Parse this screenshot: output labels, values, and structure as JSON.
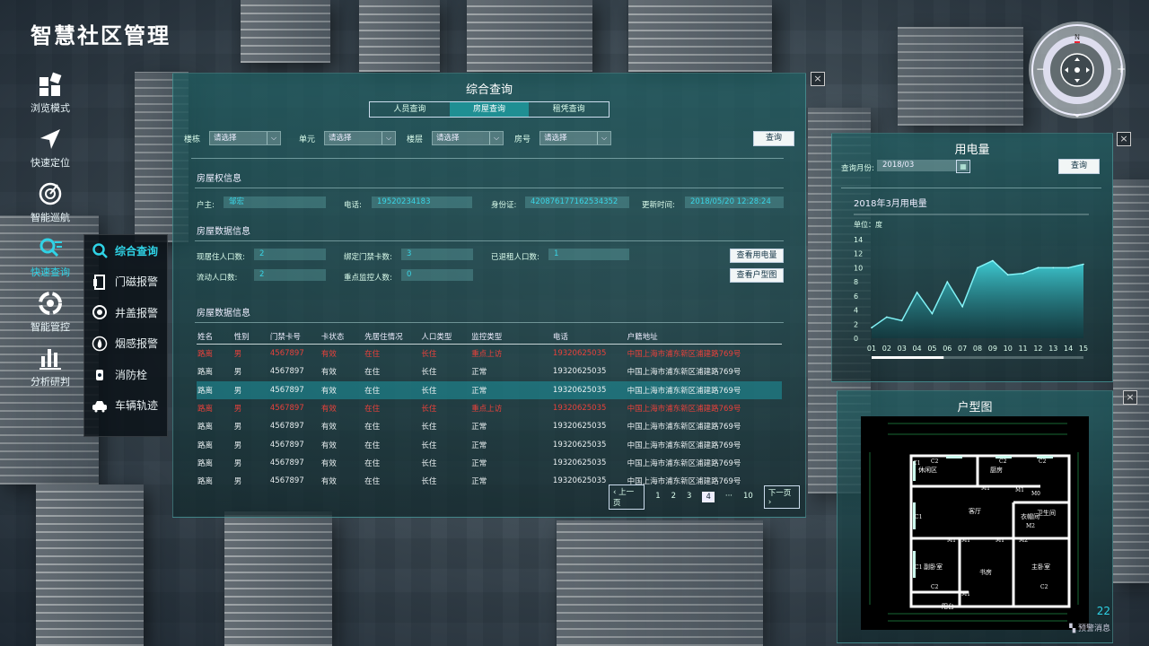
{
  "app_title": "智慧社区管理",
  "nav": [
    {
      "label": "浏览模式",
      "icon": "grid-icon"
    },
    {
      "label": "快速定位",
      "icon": "locate-arrow-icon"
    },
    {
      "label": "智能巡航",
      "icon": "radar-icon"
    },
    {
      "label": "快速查询",
      "icon": "search-list-icon",
      "active": true
    },
    {
      "label": "智能管控",
      "icon": "control-icon"
    },
    {
      "label": "分析研判",
      "icon": "bar-chart-icon"
    }
  ],
  "submenu": [
    {
      "label": "综合查询",
      "icon": "search-icon",
      "active": true
    },
    {
      "label": "门磁报警",
      "icon": "door-icon"
    },
    {
      "label": "井盖报警",
      "icon": "manhole-icon"
    },
    {
      "label": "烟感报警",
      "icon": "fire-icon"
    },
    {
      "label": "消防栓",
      "icon": "hydrant-icon"
    },
    {
      "label": "车辆轨迹",
      "icon": "car-icon"
    }
  ],
  "main": {
    "title": "综合查询",
    "close": "×",
    "tabs": [
      "人员查询",
      "房屋查询",
      "租凭查询"
    ],
    "filters": {
      "building_label": "楼栋",
      "unit_label": "单元",
      "floor_label": "楼层",
      "room_label": "房号",
      "select_value": "请选择",
      "query": "查询"
    },
    "ownership": {
      "heading": "房屋权信息",
      "owner_label": "户主:",
      "owner": "邹宏",
      "phone_label": "电话:",
      "phone": "19520234183",
      "id_label": "身份证:",
      "id": "420876177162534352",
      "updated_label": "更新时间:",
      "updated": "2018/05/20  12:28:24"
    },
    "stats": {
      "heading": "房屋数据信息",
      "resident_label": "现居住人口数:",
      "resident": "2",
      "card_label": "绑定门禁卡数:",
      "card": "3",
      "rented_label": "已退租人口数:",
      "rented": "1",
      "floating_label": "流动人口数:",
      "floating": "2",
      "monitor_label": "重点监控人数:",
      "monitor": "0",
      "btn_power": "查看用电量",
      "btn_plan": "查看户型图"
    },
    "table": {
      "heading": "房屋数据信息",
      "columns": [
        "姓名",
        "性别",
        "门禁卡号",
        "卡状态",
        "先居住情况",
        "人口类型",
        "监控类型",
        "电话",
        "户籍地址"
      ],
      "rows": [
        [
          "路离",
          "男",
          "4567897",
          "有效",
          "在住",
          "长住",
          "重点上访",
          "19320625035",
          "中国上海市浦东新区浦建路769号"
        ],
        [
          "路离",
          "男",
          "4567897",
          "有效",
          "在住",
          "长住",
          "正常",
          "19320625035",
          "中国上海市浦东新区浦建路769号"
        ],
        [
          "路离",
          "男",
          "4567897",
          "有效",
          "在住",
          "长住",
          "正常",
          "19320625035",
          "中国上海市浦东新区浦建路769号"
        ],
        [
          "路离",
          "男",
          "4567897",
          "有效",
          "在住",
          "长住",
          "重点上访",
          "19320625035",
          "中国上海市浦东新区浦建路769号"
        ],
        [
          "路离",
          "男",
          "4567897",
          "有效",
          "在住",
          "长住",
          "正常",
          "19320625035",
          "中国上海市浦东新区浦建路769号"
        ],
        [
          "路离",
          "男",
          "4567897",
          "有效",
          "在住",
          "长住",
          "正常",
          "19320625035",
          "中国上海市浦东新区浦建路769号"
        ],
        [
          "路离",
          "男",
          "4567897",
          "有效",
          "在住",
          "长住",
          "正常",
          "19320625035",
          "中国上海市浦东新区浦建路769号"
        ],
        [
          "路离",
          "男",
          "4567897",
          "有效",
          "在住",
          "长住",
          "正常",
          "19320625035",
          "中国上海市浦东新区浦建路769号"
        ]
      ],
      "red_rows": [
        0,
        3
      ],
      "highlight_row": 2
    },
    "pager": {
      "prev": "上一页",
      "next": "下一页",
      "pages": [
        "1",
        "2",
        "3",
        "4",
        "···",
        "10"
      ],
      "active": "4"
    }
  },
  "power": {
    "title": "用电量",
    "month_label": "查询月份:",
    "month_value": "2018/03",
    "query": "查询",
    "close": "×"
  },
  "chart_data": {
    "type": "area",
    "title": "2018年3月用电量",
    "ylabel": "单位：度",
    "categories": [
      "01",
      "02",
      "03",
      "04",
      "05",
      "06",
      "07",
      "08",
      "09",
      "10",
      "11",
      "12",
      "13",
      "14",
      "15"
    ],
    "values": [
      1.5,
      3,
      2.5,
      6.5,
      3.5,
      8,
      4.5,
      10,
      11,
      9,
      9.2,
      10,
      10,
      10,
      10.5
    ],
    "ylim": [
      0,
      14
    ],
    "yticks": [
      "0",
      "2",
      "4",
      "6",
      "8",
      "10",
      "12",
      "14"
    ],
    "color": "#3fd0d8"
  },
  "plan": {
    "title": "户型图",
    "close": "×",
    "rooms": [
      "休闲区",
      "厨房",
      "客厅",
      "卫生间",
      "衣帽间",
      "副卧室",
      "书房",
      "主卧室",
      "阳台"
    ],
    "codes": [
      "C1",
      "C2",
      "C2",
      "C2",
      "M1",
      "M1",
      "M0",
      "M2",
      "C1",
      "M1",
      "M1",
      "M2",
      "C1",
      "M1",
      "C2",
      "C2",
      "M1"
    ],
    "badge": "22",
    "badge_label": "预警消息"
  }
}
